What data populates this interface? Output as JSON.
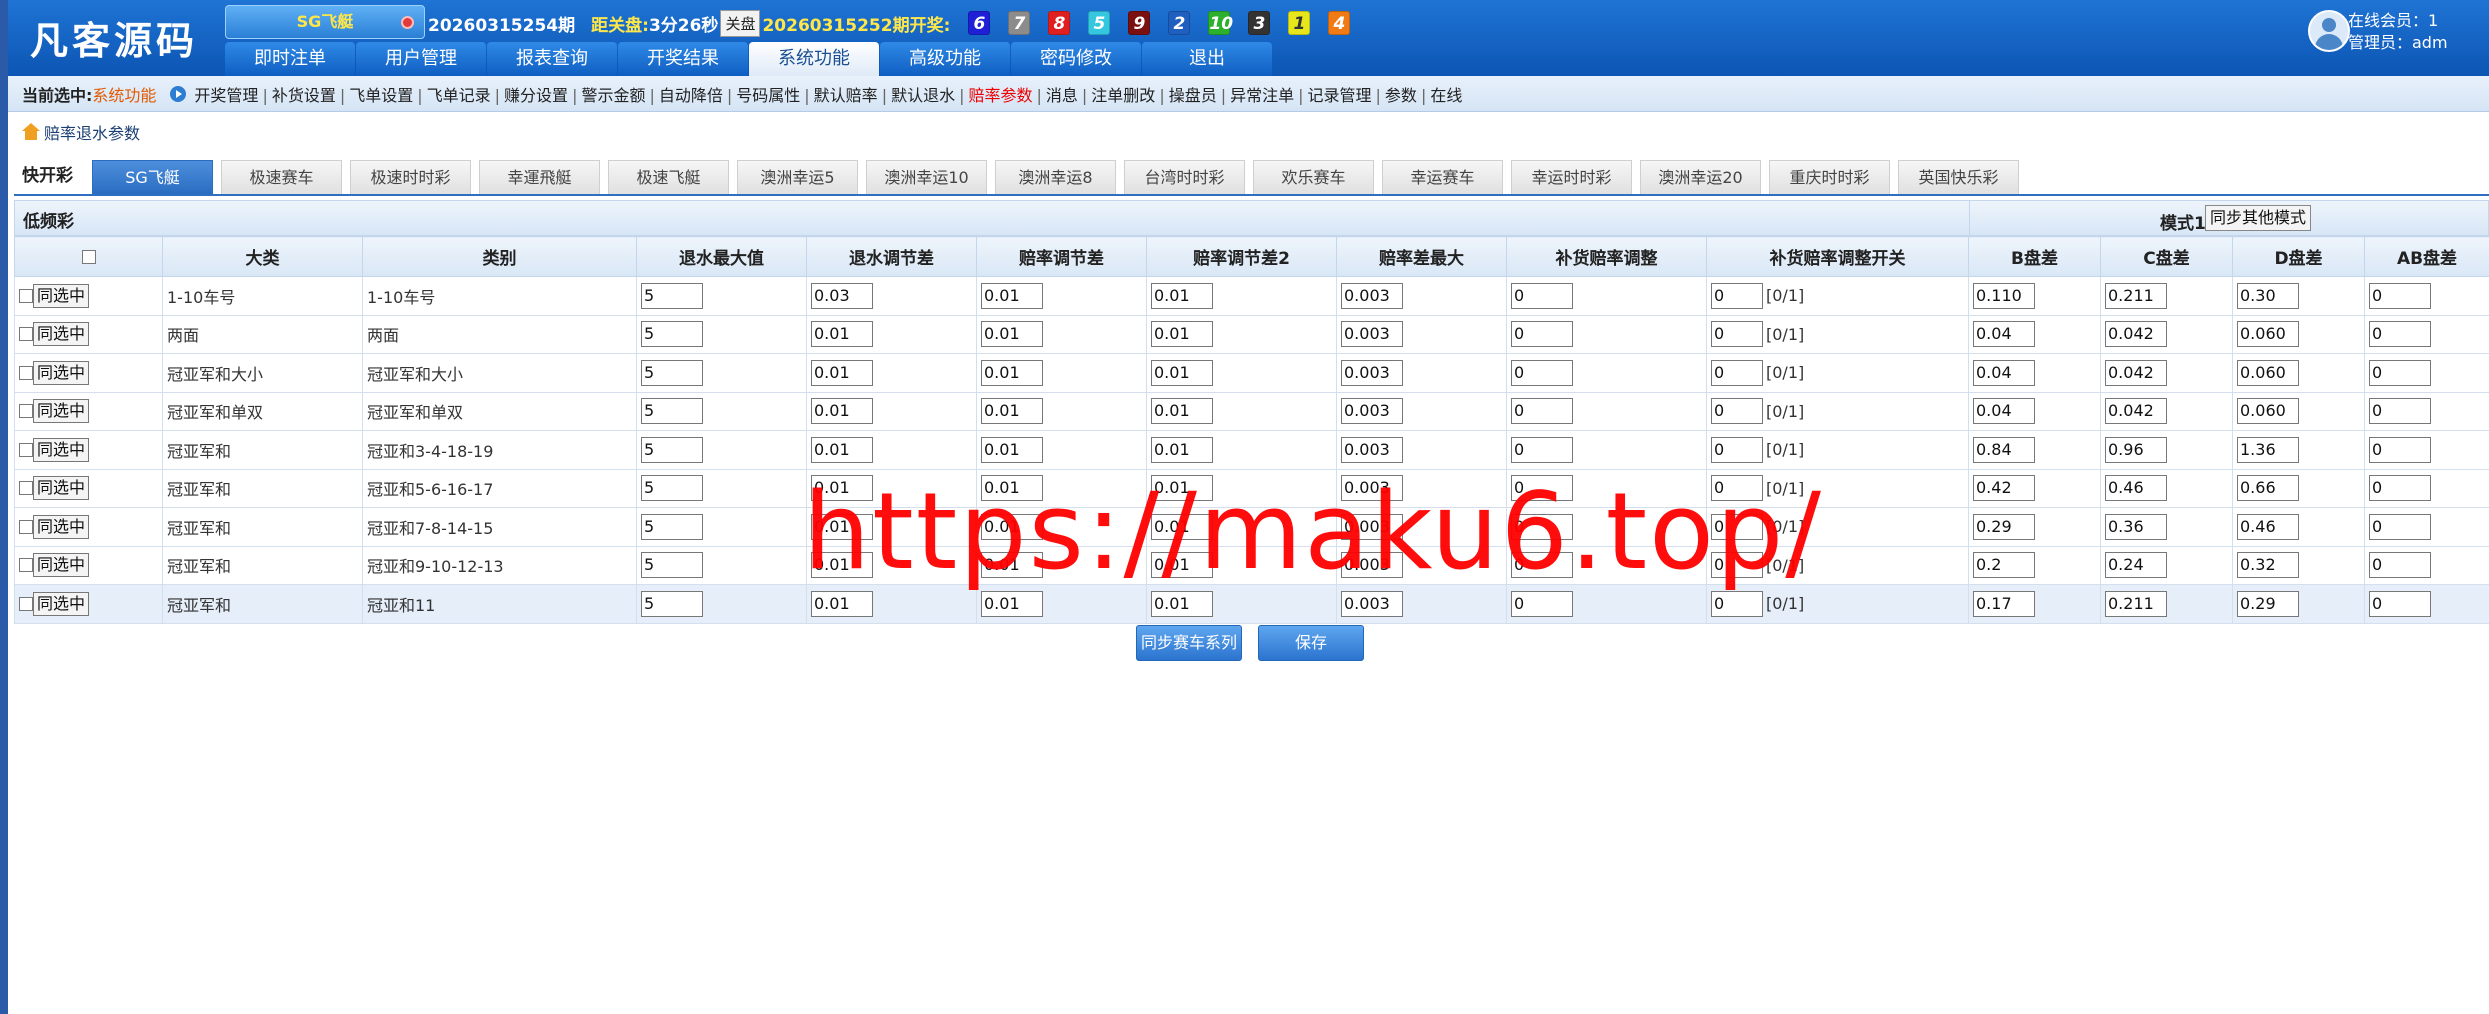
{
  "header": {
    "logo": "凡客源码",
    "lottery_select": "SG飞艇",
    "current_period": "20260315254期",
    "close_countdown_label": "距关盘:",
    "close_countdown": "3分26秒",
    "close_button": "关盘",
    "last_period_label": "20260315252期开奖:",
    "balls": [
      {
        "num": "6",
        "color": "#1f1fd6"
      },
      {
        "num": "7",
        "color": "#8c8c8c"
      },
      {
        "num": "8",
        "color": "#e02020"
      },
      {
        "num": "5",
        "color": "#35c6e0"
      },
      {
        "num": "9",
        "color": "#7a1010"
      },
      {
        "num": "2",
        "color": "#1e5fc0"
      },
      {
        "num": "10",
        "color": "#2db02d"
      },
      {
        "num": "3",
        "color": "#333333"
      },
      {
        "num": "1",
        "color": "#e6e61a"
      },
      {
        "num": "4",
        "color": "#f07a14"
      }
    ],
    "nav_tabs": [
      "即时注单",
      "用户管理",
      "报表查询",
      "开奖结果",
      "系统功能",
      "高级功能",
      "密码修改",
      "退出"
    ],
    "active_tab": "系统功能",
    "online_members": "在线会员：1",
    "admin": "管理员：adm"
  },
  "subnav": {
    "current_label": "当前选中:",
    "current_value": "系统功能",
    "items": [
      "开奖管理",
      "补货设置",
      "飞单设置",
      "飞单记录",
      "赚分设置",
      "警示金额",
      "自动降倍",
      "号码属性",
      "默认赔率",
      "默认退水",
      "赔率参数",
      "消息",
      "注单删改",
      "操盘员",
      "异常注单",
      "记录管理",
      "参数",
      "在线"
    ],
    "active_item": "赔率参数"
  },
  "breadcrumb": "赔率退水参数",
  "game_tabs": {
    "category": "快开彩",
    "tabs": [
      "SG飞艇",
      "极速赛车",
      "极速时时彩",
      "幸運飛艇",
      "极速飞艇",
      "澳洲幸运5",
      "澳洲幸运10",
      "澳洲幸运8",
      "台湾时时彩",
      "欢乐赛车",
      "幸运赛车",
      "幸运时时彩",
      "澳洲幸运20",
      "重庆时时彩",
      "英国快乐彩"
    ],
    "active": "SG飞艇"
  },
  "low_freq_label": "低频彩",
  "mode_label": "模式1",
  "sync_mode_button": "同步其他模式",
  "table": {
    "headers": [
      "",
      "大类",
      "类别",
      "退水最大值",
      "退水调节差",
      "赔率调节差",
      "赔率调节差2",
      "赔率差最大",
      "补货赔率调整",
      "补货赔率调整开关",
      "B盘差",
      "C盘差",
      "D盘差",
      "AB盘差"
    ],
    "sync_button": "同选中",
    "switch_range": "[0/1]",
    "rows": [
      {
        "major": "1-10车号",
        "cat": "1-10车号",
        "v": [
          "5",
          "0.03",
          "0.01",
          "0.01",
          "0.003",
          "0",
          "0",
          "0.110",
          "0.211",
          "0.30",
          "0"
        ]
      },
      {
        "major": "两面",
        "cat": "两面",
        "v": [
          "5",
          "0.01",
          "0.01",
          "0.01",
          "0.003",
          "0",
          "0",
          "0.04",
          "0.042",
          "0.060",
          "0"
        ]
      },
      {
        "major": "冠亚军和大小",
        "cat": "冠亚军和大小",
        "v": [
          "5",
          "0.01",
          "0.01",
          "0.01",
          "0.003",
          "0",
          "0",
          "0.04",
          "0.042",
          "0.060",
          "0"
        ]
      },
      {
        "major": "冠亚军和单双",
        "cat": "冠亚军和单双",
        "v": [
          "5",
          "0.01",
          "0.01",
          "0.01",
          "0.003",
          "0",
          "0",
          "0.04",
          "0.042",
          "0.060",
          "0"
        ]
      },
      {
        "major": "冠亚军和",
        "cat": "冠亚和3-4-18-19",
        "v": [
          "5",
          "0.01",
          "0.01",
          "0.01",
          "0.003",
          "0",
          "0",
          "0.84",
          "0.96",
          "1.36",
          "0"
        ]
      },
      {
        "major": "冠亚军和",
        "cat": "冠亚和5-6-16-17",
        "v": [
          "5",
          "0.01",
          "0.01",
          "0.01",
          "0.003",
          "0",
          "0",
          "0.42",
          "0.46",
          "0.66",
          "0"
        ]
      },
      {
        "major": "冠亚军和",
        "cat": "冠亚和7-8-14-15",
        "v": [
          "5",
          "0.01",
          "0.01",
          "0.01",
          "0.003",
          "0",
          "0",
          "0.29",
          "0.36",
          "0.46",
          "0"
        ]
      },
      {
        "major": "冠亚军和",
        "cat": "冠亚和9-10-12-13",
        "v": [
          "5",
          "0.01",
          "0.01",
          "0.01",
          "0.003",
          "0",
          "0",
          "0.2",
          "0.24",
          "0.32",
          "0"
        ]
      },
      {
        "major": "冠亚军和",
        "cat": "冠亚和11",
        "v": [
          "5",
          "0.01",
          "0.01",
          "0.01",
          "0.003",
          "0",
          "0",
          "0.17",
          "0.211",
          "0.29",
          "0"
        ]
      }
    ]
  },
  "buttons": {
    "sync_series": "同步赛车系列",
    "save": "保存"
  },
  "watermark": "https://maku6.top/"
}
